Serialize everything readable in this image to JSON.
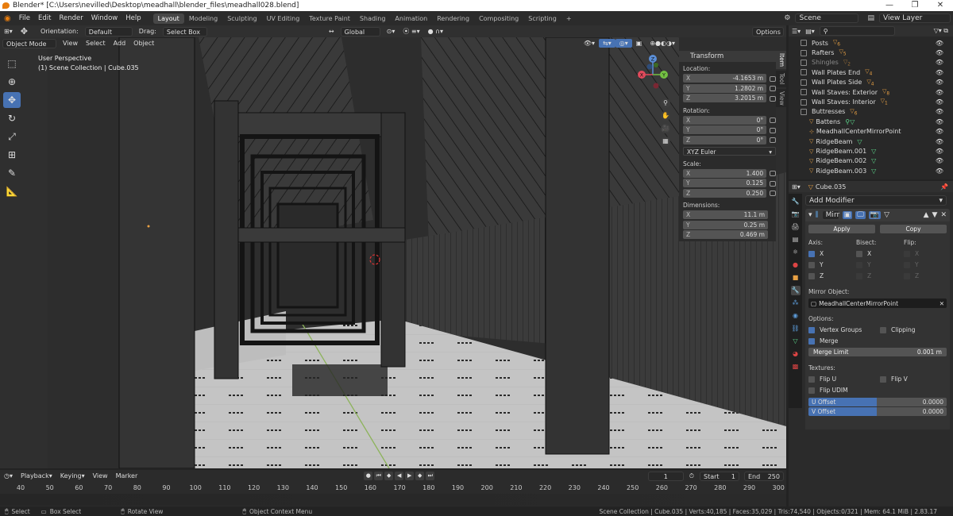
{
  "window": {
    "title": "Blender* [C:\\Users\\nevilled\\Desktop\\meadhall\\blender_files\\meadhall028.blend]",
    "minimize": "—",
    "maximize": "❐",
    "close": "✕"
  },
  "menu": [
    "File",
    "Edit",
    "Render",
    "Window",
    "Help"
  ],
  "workspaces": [
    "Layout",
    "Modeling",
    "Sculpting",
    "UV Editing",
    "Texture Paint",
    "Shading",
    "Animation",
    "Rendering",
    "Compositing",
    "Scripting",
    "+"
  ],
  "scene": {
    "label": "Scene",
    "view_layer": "View Layer"
  },
  "viewport_header": {
    "orientation_label": "Orientation:",
    "orientation_value": "Default",
    "drag_label": "Drag:",
    "drag_value": "Select Box",
    "transform_orientation": "Global",
    "options": "Options"
  },
  "viewport_header2": {
    "mode": "Object Mode",
    "items": [
      "View",
      "Select",
      "Add",
      "Object"
    ]
  },
  "viewport_info": {
    "line1": "User Perspective",
    "line2": "(1) Scene Collection | Cube.035"
  },
  "gizmo": {
    "x": "X",
    "y": "Y",
    "z": "Z"
  },
  "npanel": {
    "title": "Transform",
    "location_label": "Location:",
    "location": [
      {
        "axis": "X",
        "value": "-4.1653 m"
      },
      {
        "axis": "Y",
        "value": "1.2802 m"
      },
      {
        "axis": "Z",
        "value": "3.2015 m"
      }
    ],
    "rotation_label": "Rotation:",
    "rotation": [
      {
        "axis": "X",
        "value": "0°"
      },
      {
        "axis": "Y",
        "value": "0°"
      },
      {
        "axis": "Z",
        "value": "0°"
      }
    ],
    "rotation_mode": "XYZ Euler",
    "scale_label": "Scale:",
    "scale": [
      {
        "axis": "X",
        "value": "1.400"
      },
      {
        "axis": "Y",
        "value": "0.125"
      },
      {
        "axis": "Z",
        "value": "0.250"
      }
    ],
    "dimensions_label": "Dimensions:",
    "dimensions": [
      {
        "axis": "X",
        "value": "11.1 m"
      },
      {
        "axis": "Y",
        "value": "0.25 m"
      },
      {
        "axis": "Z",
        "value": "0.469 m"
      }
    ],
    "tabs": [
      "Item",
      "Tool",
      "View"
    ]
  },
  "outliner": {
    "rows": [
      {
        "name": "Posts",
        "type": "coll",
        "badge": "6",
        "checked": true
      },
      {
        "name": "Rafters",
        "type": "coll",
        "badge": "5",
        "checked": true
      },
      {
        "name": "Shingles",
        "type": "coll",
        "badge": "2",
        "checked": true,
        "dim": true
      },
      {
        "name": "Wall Plates End",
        "type": "coll",
        "badge": "4",
        "checked": true
      },
      {
        "name": "Wall Plates Side",
        "type": "coll",
        "badge": "4",
        "checked": true
      },
      {
        "name": "Wall Staves: Exterior",
        "type": "coll",
        "badge": "8",
        "checked": true
      },
      {
        "name": "Wall Staves: Interior",
        "type": "coll",
        "badge": "1",
        "checked": true
      },
      {
        "name": "Buttresses",
        "type": "coll",
        "badge": "6",
        "checked": true
      },
      {
        "name": "Battens",
        "type": "obj"
      },
      {
        "name": "MeadhallCenterMirrorPoint",
        "type": "obj"
      },
      {
        "name": "RidgeBeam",
        "type": "obj"
      },
      {
        "name": "RidgeBeam.001",
        "type": "obj"
      },
      {
        "name": "RidgeBeam.002",
        "type": "obj"
      },
      {
        "name": "RidgeBeam.003",
        "type": "obj"
      }
    ]
  },
  "properties": {
    "object_name": "Cube.035",
    "add_modifier": "Add Modifier",
    "modifier_name": "Mirr",
    "apply": "Apply",
    "copy": "Copy",
    "axis_label": "Axis:",
    "bisect_label": "Bisect:",
    "flip_label": "Flip:",
    "axis": [
      "X",
      "Y",
      "Z"
    ],
    "mirror_object_label": "Mirror Object:",
    "mirror_object": "MeadhallCenterMirrorPoint",
    "options_label": "Options:",
    "vertex_groups": "Vertex Groups",
    "clipping": "Clipping",
    "merge": "Merge",
    "merge_limit_label": "Merge Limit",
    "merge_limit": "0.001 m",
    "textures_label": "Textures:",
    "flip_u": "Flip U",
    "flip_v": "Flip V",
    "flip_udim": "Flip UDIM",
    "u_offset_label": "U Offset",
    "u_offset": "0.0000",
    "v_offset_label": "V Offset",
    "v_offset": "0.0000"
  },
  "timeline": {
    "items": [
      "Playback",
      "Keying",
      "View",
      "Marker"
    ],
    "current_frame": "1",
    "start_label": "Start",
    "start": "1",
    "end_label": "End",
    "end": "250",
    "ruler": [
      "40",
      "50",
      "60",
      "70",
      "80",
      "90",
      "100",
      "110",
      "120",
      "130",
      "140",
      "150",
      "160",
      "170",
      "180",
      "190",
      "200",
      "210",
      "220",
      "230",
      "240",
      "250",
      "260",
      "270",
      "280",
      "290",
      "300"
    ]
  },
  "statusbar": {
    "select": "Select",
    "box_select": "Box Select",
    "rotate_view": "Rotate View",
    "context_menu": "Object Context Menu",
    "stats": "Scene Collection | Cube.035 | Verts:40,185 | Faces:35,029 | Tris:74,540 | Objects:0/321 | Mem: 64.1 MiB | 2.83.17"
  },
  "colors": {
    "accent": "#4772b3",
    "orange": "#e8a043",
    "green": "#5cd68b",
    "bg": "#2b2b2b"
  }
}
